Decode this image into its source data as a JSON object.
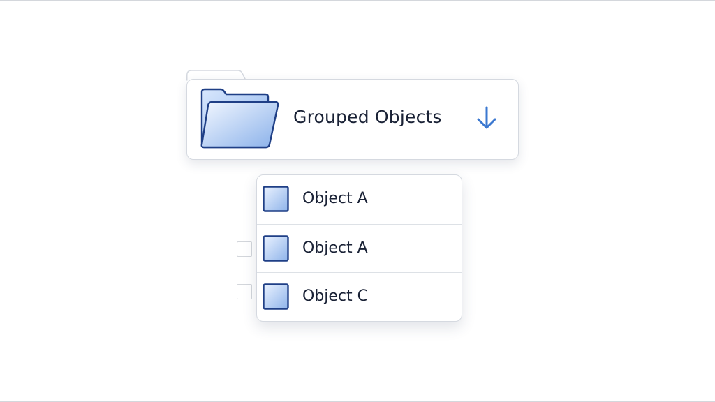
{
  "group": {
    "title": "Grouped Objects",
    "icon": "folder-icon",
    "expand_icon": "arrow-down-icon",
    "accent_color": "#3b78d0"
  },
  "objects": [
    {
      "label": "Object A",
      "icon": "square-object-icon"
    },
    {
      "label": "Object A",
      "icon": "square-object-icon"
    },
    {
      "label": "Object C",
      "icon": "square-object-icon"
    }
  ],
  "checkboxes": [
    {
      "checked": false
    },
    {
      "checked": false
    }
  ],
  "colors": {
    "border": "#d5d9e0",
    "text": "#1a2236",
    "icon_stroke": "#1f3f86",
    "icon_fill_light": "#e8f1ff",
    "icon_fill_dark": "#9ec0ee"
  }
}
